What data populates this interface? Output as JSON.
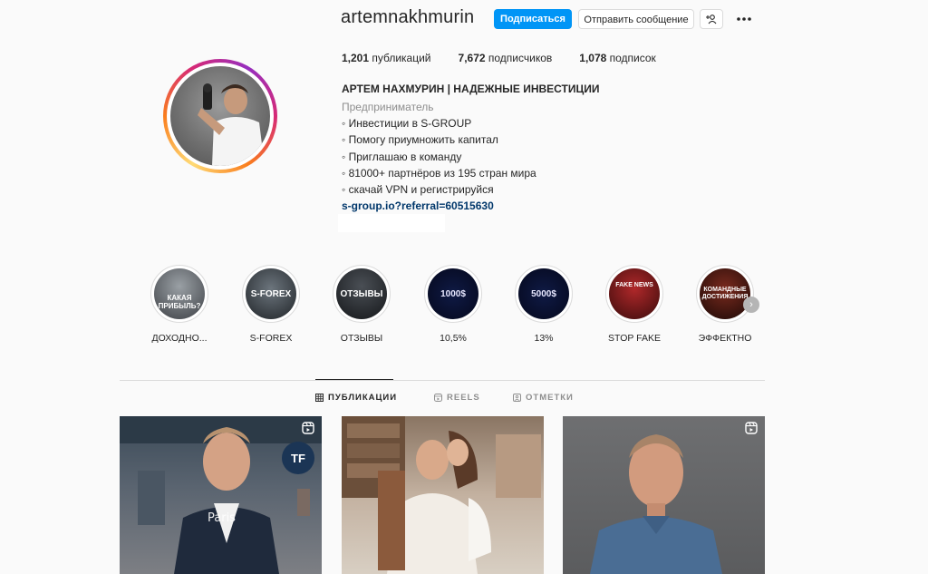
{
  "profile": {
    "username": "artemnakhmurin",
    "follow_label": "Подписаться",
    "message_label": "Отправить сообщение",
    "full_name": "АРТЕМ НАХМУРИН | НАДЕЖНЫЕ ИНВЕСТИЦИИ",
    "category": "Предприниматель",
    "bio_lines": [
      "◦ Инвестиции в S-GROUP",
      "◦ Помогу приумножить капитал",
      "◦ Приглашаю в команду",
      "◦ 81000+ партнёров из 195 стран мира",
      "◦ скачай VPN и регистрируйся"
    ],
    "link": "s-group.io?referral=60515630"
  },
  "stats": {
    "posts_count": "1,201",
    "posts_label": "публикаций",
    "followers_count": "7,672",
    "followers_label": "подписчиков",
    "following_count": "1,078",
    "following_label": "подписок"
  },
  "highlights": [
    {
      "label": "ДОХОДНО...",
      "cover_text": "КАКАЯ ПРИБЫЛЬ?"
    },
    {
      "label": "S-FOREX",
      "cover_text": "S-FOREX"
    },
    {
      "label": "ОТЗЫВЫ",
      "cover_text": "ОТЗЫВЫ"
    },
    {
      "label": "10,5%",
      "cover_text": "1000$"
    },
    {
      "label": "13%",
      "cover_text": "5000$"
    },
    {
      "label": "STOP FAKE",
      "cover_text": "FAKE NEWS"
    },
    {
      "label": "ЭФФЕКТНО",
      "cover_text": "КОМАНДНЫЕ ДОСТИЖЕНИЯ"
    }
  ],
  "tabs": [
    {
      "label": "ПУБЛИКАЦИИ",
      "icon": "grid-icon",
      "active": true
    },
    {
      "label": "REELS",
      "icon": "reels-icon",
      "active": false
    },
    {
      "label": "ОТМЕТКИ",
      "icon": "tagged-icon",
      "active": false
    }
  ],
  "posts": [
    {
      "icon": "reels-icon",
      "overlay_text": "Paris"
    },
    {
      "icon": null
    },
    {
      "icon": "reels-icon"
    }
  ],
  "colors": {
    "accent": "#0095f6",
    "link": "#00376b",
    "text": "#262626",
    "secondary": "#8e8e8e",
    "border": "#dbdbdb",
    "background": "#fafafa"
  }
}
